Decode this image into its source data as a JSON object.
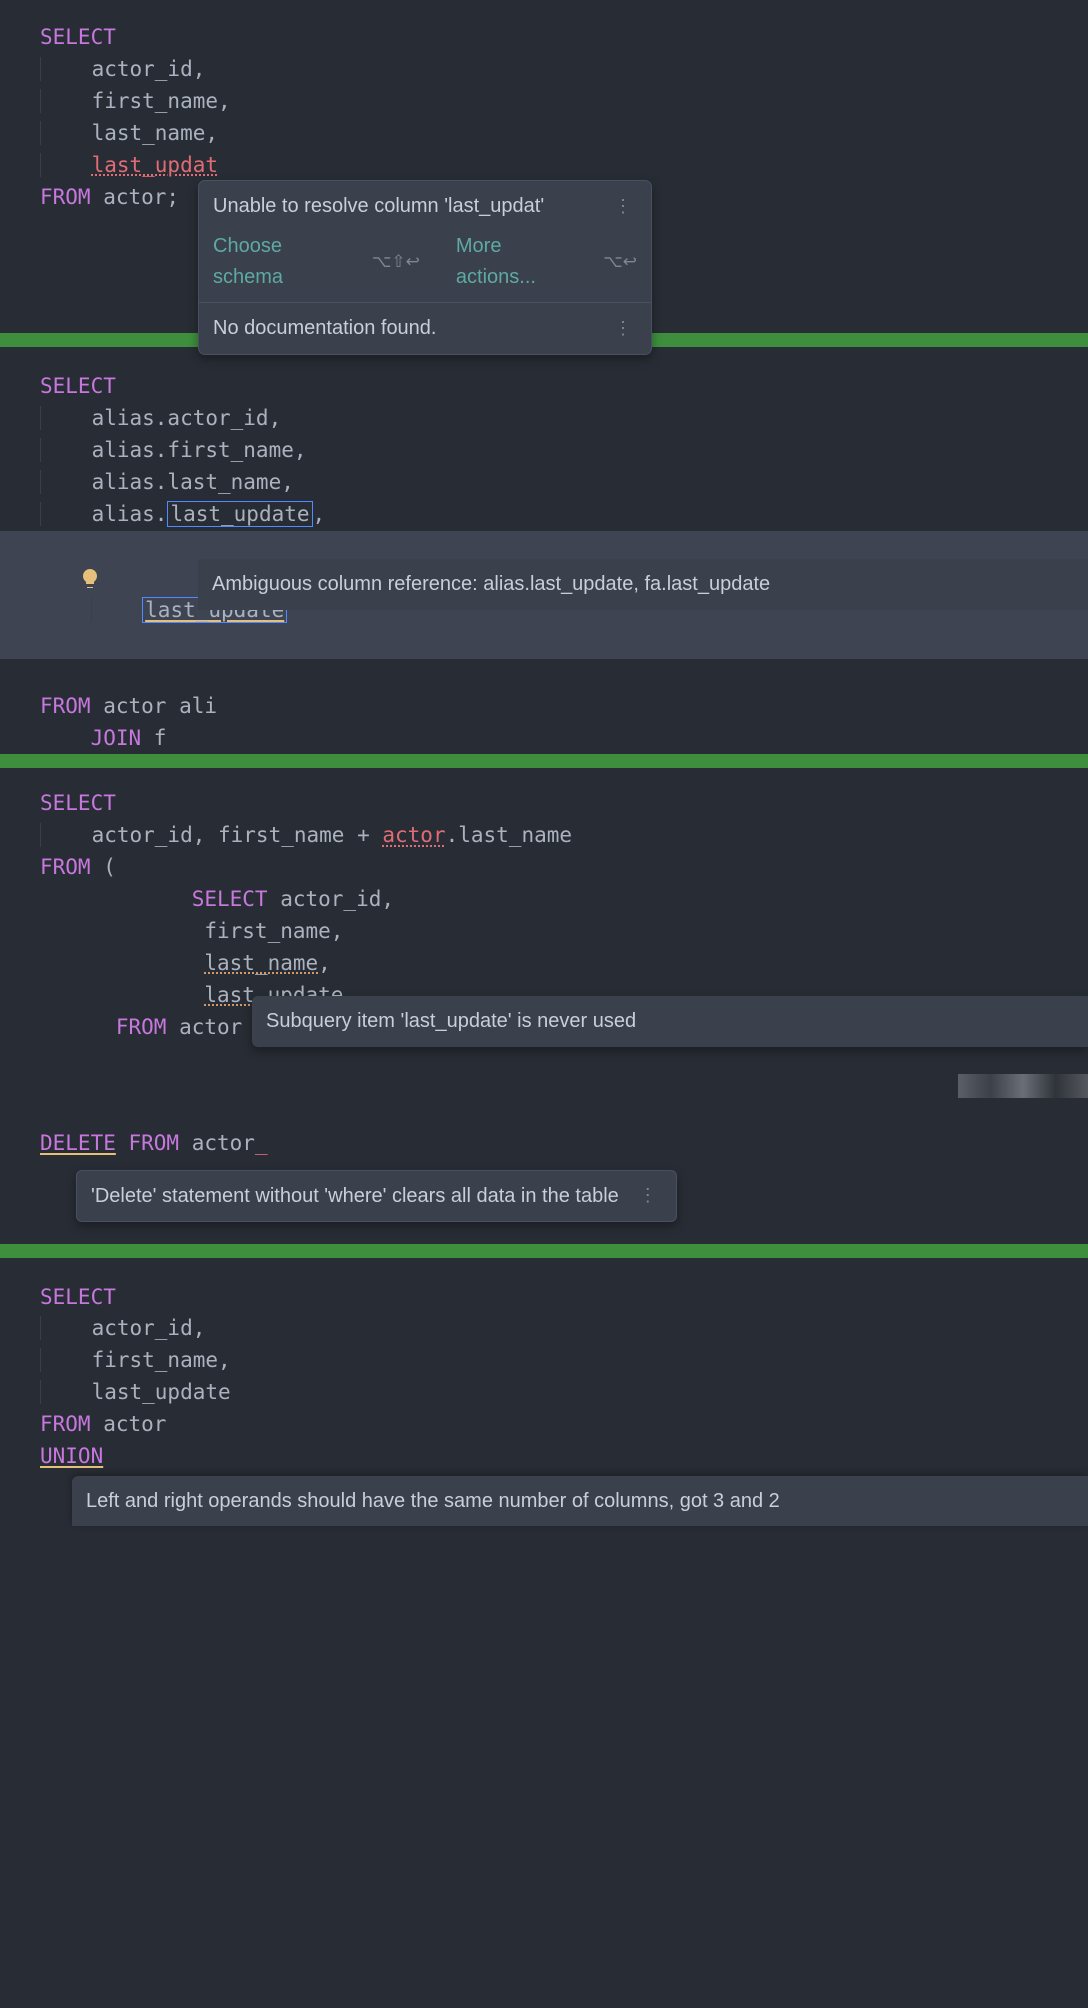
{
  "block1": {
    "l1": "SELECT",
    "l2": "    actor_id,",
    "l3": "    first_name,",
    "l4": "    last_name,",
    "l5_err": "last_updat",
    "l6a": "FROM",
    "l6b": " actor;",
    "tooltip": {
      "msg": "Unable to resolve column 'last_updat'",
      "act1": "Choose schema",
      "sc1": "⌥⇧↩",
      "act2": "More actions...",
      "sc2": "⌥↩",
      "nodoc": "No documentation found."
    }
  },
  "block2": {
    "l1": "SELECT",
    "l2": "    alias.actor_id,",
    "l3": "    alias.first_name,",
    "l4": "    alias.last_name,",
    "l5a": "    alias.",
    "l5b": "last_update",
    "l5c": ",",
    "l6_err": "last_update",
    "l7a": "FROM",
    "l7b": " actor ali",
    "l8": "     JOIN f",
    "tooltip": "Ambiguous column reference: alias.last_update, fa.last_update"
  },
  "block3": {
    "l1": "SELECT",
    "l2a": "    actor_id, first_name + ",
    "l2_err": "actor",
    "l2b": ".last_name",
    "l3a": "FROM",
    "l3b": " (",
    "l4": "      SELECT",
    "l4b": " actor_id,",
    "l5": "             first_name,",
    "l6a": "             ",
    "l6_warn": "last_name",
    "l6b": ",",
    "l7a": "             ",
    "l7_warn": "last_update",
    "l8a": "      FROM",
    "l8b": " actor",
    "tooltip": "Subquery item 'last_update' is never used"
  },
  "block4": {
    "l1a": "DELETE",
    "l1b": " FROM",
    "l1c": " actor",
    "tooltip": "'Delete' statement without 'where' clears all data in the table"
  },
  "block5": {
    "l1": "SELECT",
    "l2": "    actor_id,",
    "l3": "    first_name,",
    "l4": "    last_update",
    "l5a": "FROM",
    "l5b": " actor",
    "l6": "UNION",
    "tooltip": "Left and right operands should have the same number of columns, got 3 and 2"
  }
}
